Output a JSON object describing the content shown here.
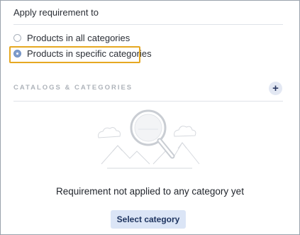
{
  "apply_section": {
    "title": "Apply requirement to",
    "options": [
      {
        "label": "Products in all categories",
        "selected": false
      },
      {
        "label": "Products in specific categories",
        "selected": true
      }
    ]
  },
  "catalogs": {
    "header": "CATALOGS & CATEGORIES",
    "add_icon": "plus-icon"
  },
  "empty_state": {
    "illustration": "magnifier-search-icon",
    "message": "Requirement not applied to any category yet",
    "button_label": "Select category"
  },
  "colors": {
    "highlight": "#e6a822",
    "accent": "#7f9ccc",
    "button_bg": "#dbe5f6"
  }
}
